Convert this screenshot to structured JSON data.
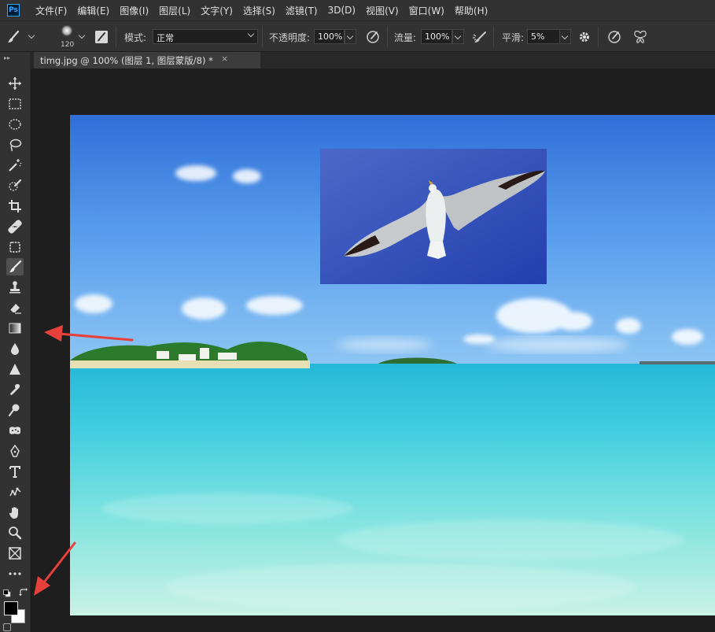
{
  "app": {
    "logo_text": "Ps"
  },
  "menu": [
    "文件(F)",
    "编辑(E)",
    "图像(I)",
    "图层(L)",
    "文字(Y)",
    "选择(S)",
    "滤镜(T)",
    "3D(D)",
    "视图(V)",
    "窗口(W)",
    "帮助(H)"
  ],
  "options": {
    "brush_size": "120",
    "mode_label": "模式:",
    "mode_value": "正常",
    "opacity_label": "不透明度:",
    "opacity_value": "100%",
    "flow_label": "流量:",
    "flow_value": "100%",
    "smooth_label": "平滑:",
    "smooth_value": "5%"
  },
  "document_tab": {
    "title": "timg.jpg @ 100% (图层 1, 图层蒙版/8) *",
    "close": "×"
  },
  "tools": [
    "move-tool",
    "marquee-tool",
    "elliptical-marquee-tool",
    "lasso-tool",
    "magic-wand-tool",
    "quick-selection-tool",
    "crop-tool",
    "healing-brush-tool",
    "patch-tool",
    "brush-tool",
    "clone-stamp-tool",
    "eraser-tool",
    "gradient-tool",
    "blur-tool",
    "sharpen-tool",
    "smudge-tool",
    "dodge-tool",
    "sponge-tool",
    "pen-tool",
    "type-tool",
    "puppet-warp-tool",
    "hand-tool",
    "zoom-tool",
    "frame-tool",
    "more-tools"
  ],
  "active_tool": "brush-tool",
  "colors": {
    "foreground": "#000000",
    "background": "#ffffff",
    "annotation_arrow": "#e8403a",
    "ui_dark": "#323232",
    "canvas_bg": "#1e1e1e"
  }
}
